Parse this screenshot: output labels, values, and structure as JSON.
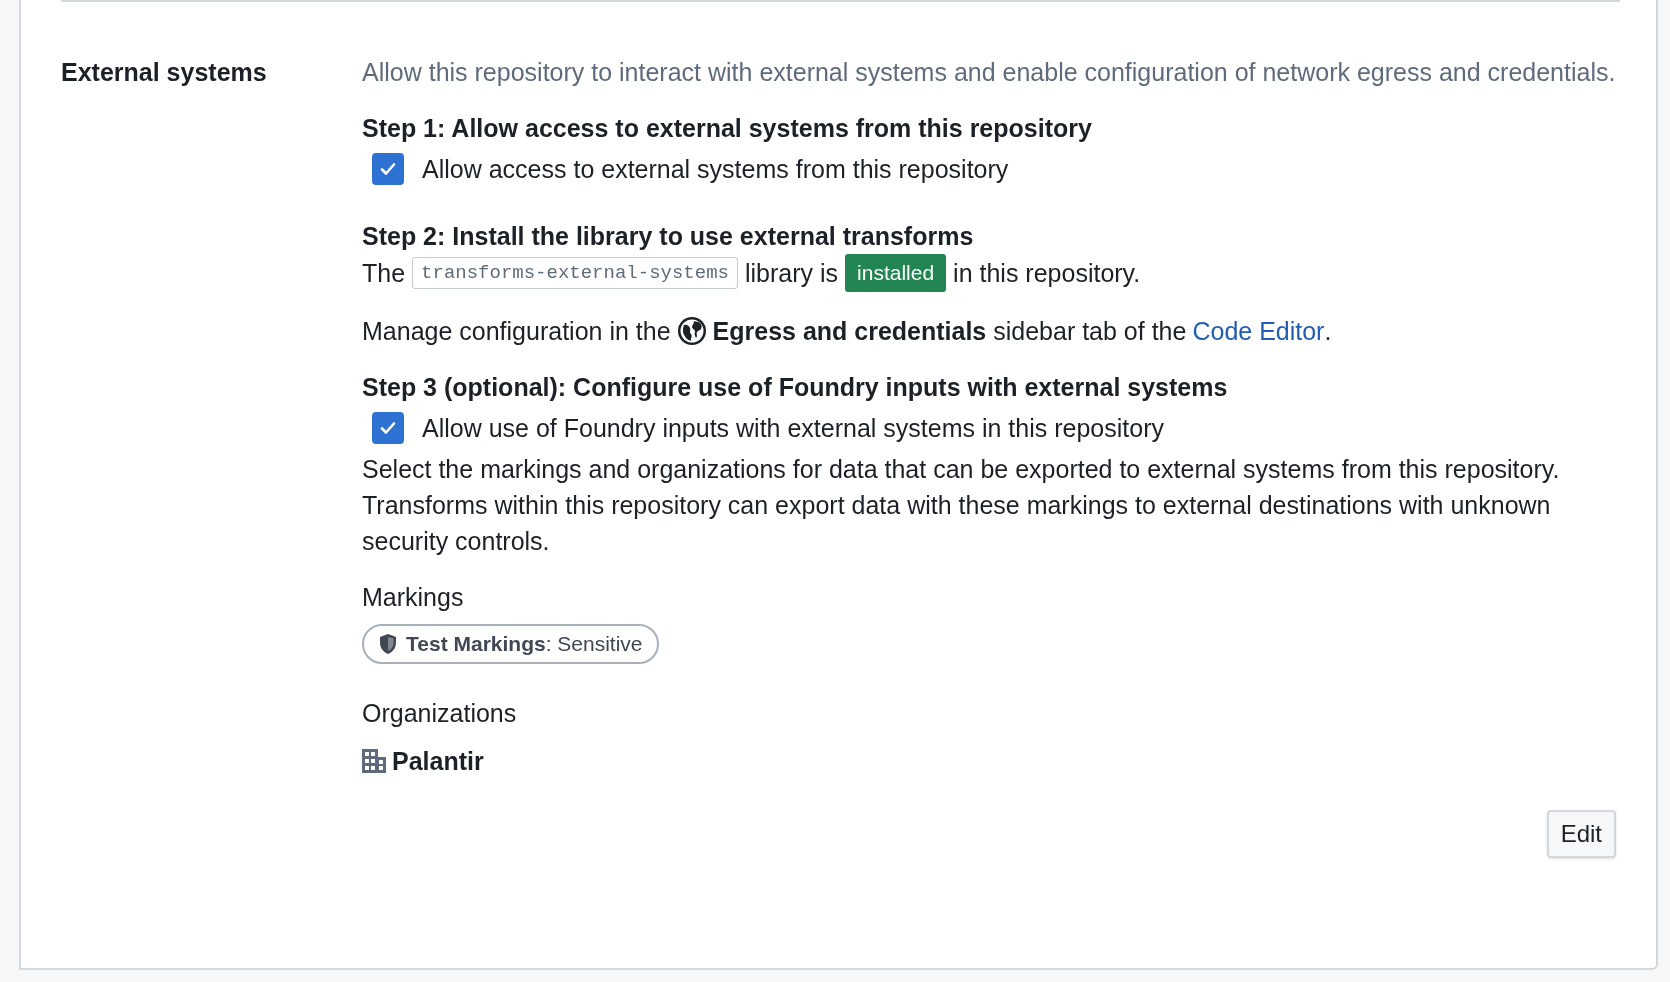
{
  "section": {
    "label": "External systems",
    "description": "Allow this repository to interact with external systems and enable configuration of network egress and credentials.",
    "step1": {
      "heading": "Step 1: Allow access to external systems from this repository",
      "checkbox": {
        "label": "Allow access to external systems from this repository",
        "checked": true
      }
    },
    "step2": {
      "heading": "Step 2: Install the library to use external transforms",
      "before": "The",
      "library": "transforms-external-systems",
      "middle": "library is",
      "status": "installed",
      "after": "in this repository."
    },
    "manage": {
      "before": "Manage configuration in the",
      "middle": "**Egress and credentials** sidebar tab of the",
      "link": "Code Editor",
      "after": "."
    },
    "step3": {
      "heading": "Step 3 (optional): Configure use of Foundry inputs with external systems",
      "checkbox": {
        "label": "Allow use of Foundry inputs with external systems in this repository",
        "checked": true
      },
      "note": "Select the markings and organizations for data that can be exported to external systems from this repository. Transforms within this repository can export data with these markings to external destinations with unknown security controls."
    },
    "markings": {
      "label": "Markings",
      "items": [
        {
          "text": "**Test Markings**: Sensitive"
        }
      ]
    },
    "organizations": {
      "label": "Organizations",
      "items": [
        "Palantir"
      ]
    },
    "edit_button": "Edit"
  }
}
